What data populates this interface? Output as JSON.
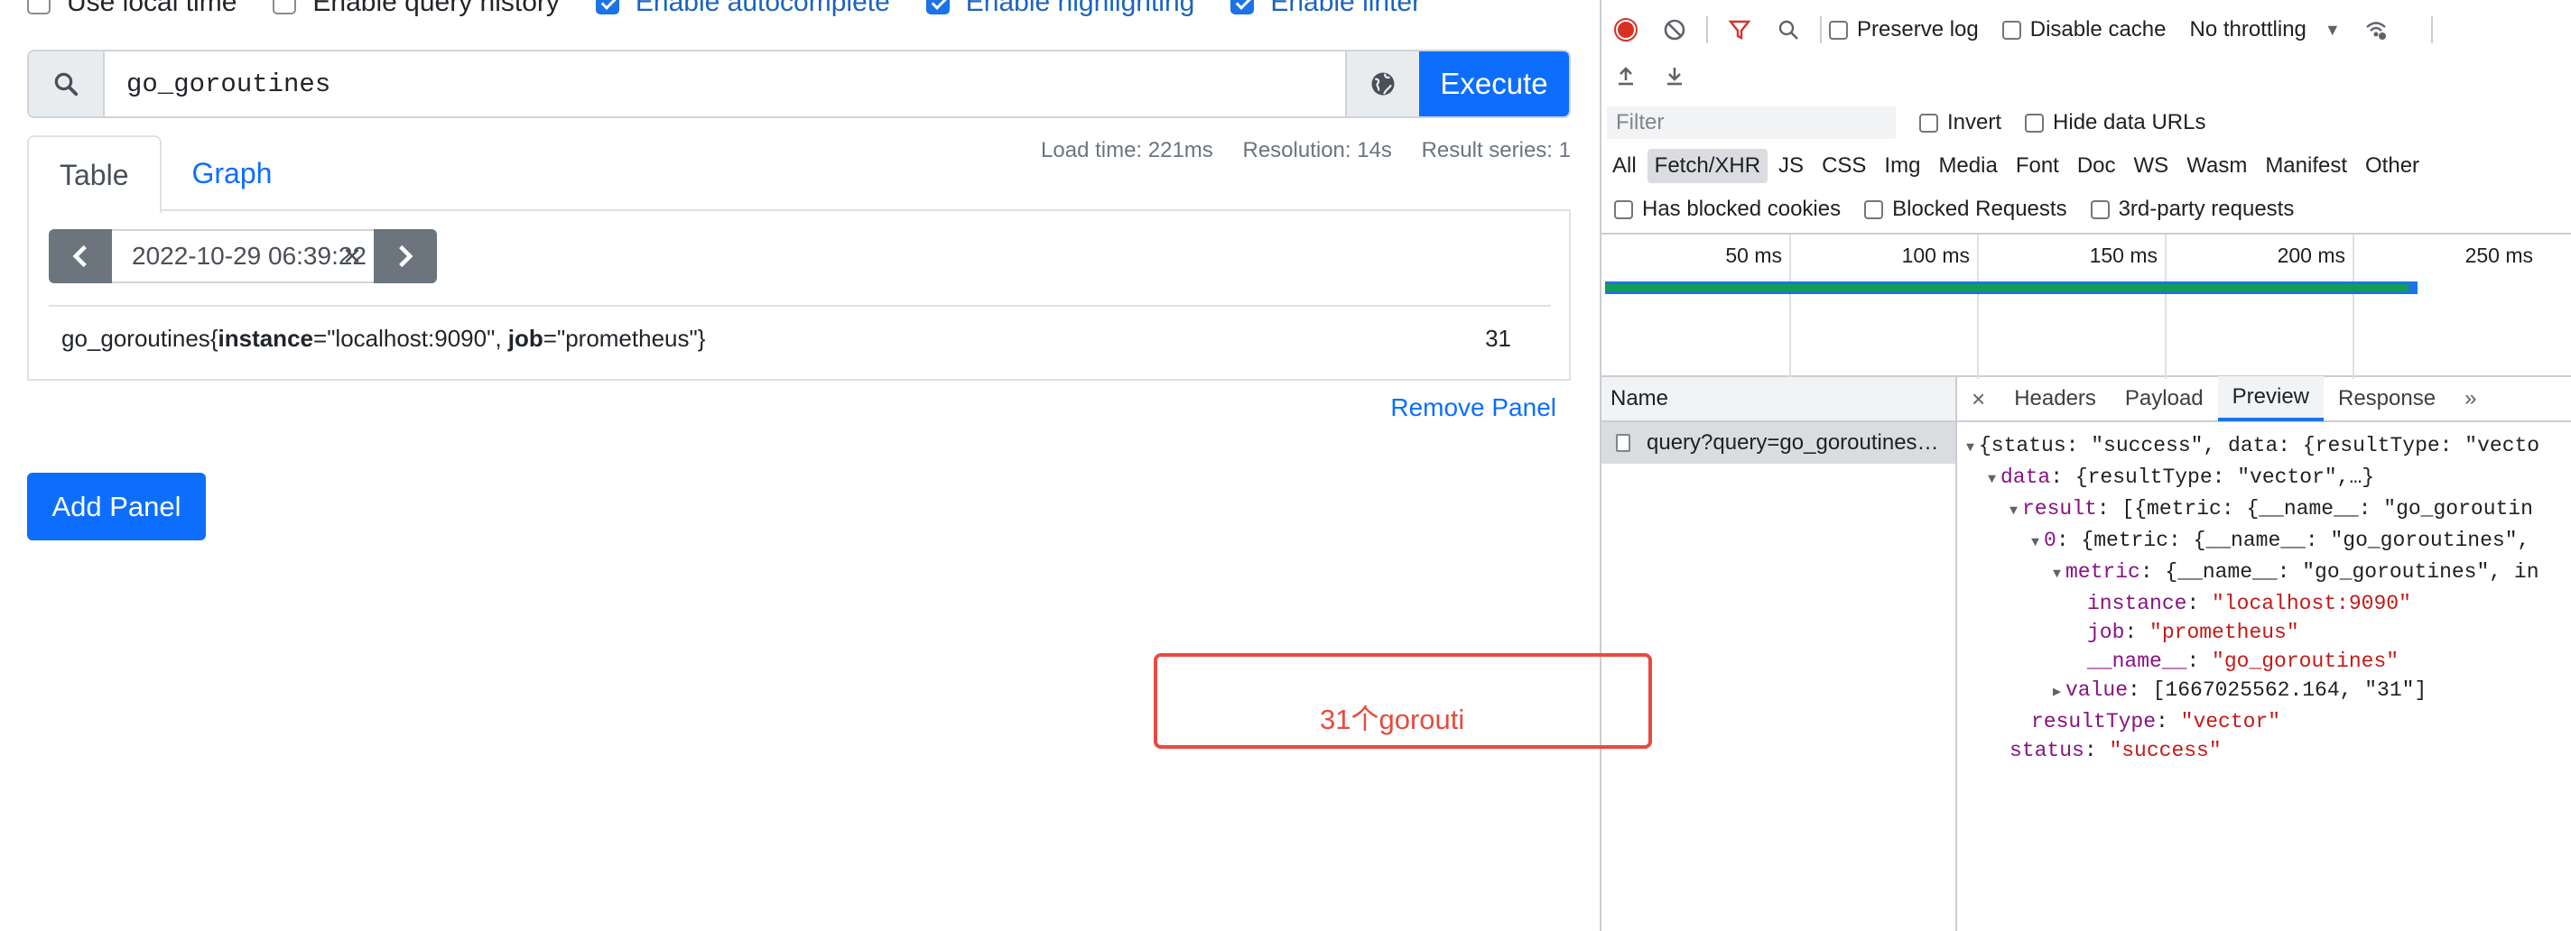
{
  "prometheus": {
    "options": [
      {
        "label": "Use local time",
        "checked": false
      },
      {
        "label": "Enable query history",
        "checked": false
      },
      {
        "label": "Enable autocomplete",
        "checked": true
      },
      {
        "label": "Enable highlighting",
        "checked": true
      },
      {
        "label": "Enable linter",
        "checked": true
      }
    ],
    "query": {
      "value": "go_goroutines",
      "execute_label": "Execute"
    },
    "tabs": [
      {
        "label": "Table",
        "active": true
      },
      {
        "label": "Graph",
        "active": false
      }
    ],
    "stats": {
      "load_time": "Load time: 221ms",
      "resolution": "Resolution: 14s",
      "result_series": "Result series: 1"
    },
    "eval_time": "2022-10-29 06:39:22",
    "result": {
      "metric_name": "go_goroutines",
      "label1_key": "instance",
      "label1_value": "\"localhost:9090\"",
      "label2_key": "job",
      "label2_value": "\"prometheus\"",
      "value": "31"
    },
    "remove_panel": "Remove Panel",
    "add_panel": "Add Panel"
  },
  "devtools": {
    "preserve_log": "Preserve log",
    "disable_cache": "Disable cache",
    "throttling": "No throttling",
    "filter_placeholder": "Filter",
    "invert": "Invert",
    "hide_data_urls": "Hide data URLs",
    "types": [
      "All",
      "Fetch/XHR",
      "JS",
      "CSS",
      "Img",
      "Media",
      "Font",
      "Doc",
      "WS",
      "Wasm",
      "Manifest",
      "Other"
    ],
    "selected_type": "Fetch/XHR",
    "blocked_cookies": "Has blocked cookies",
    "blocked_requests": "Blocked Requests",
    "third_party": "3rd-party requests",
    "timeline_labels": [
      "50 ms",
      "100 ms",
      "150 ms",
      "200 ms",
      "250 ms"
    ],
    "name_header": "Name",
    "request_name": "query?query=go_goroutines…",
    "panel_tabs": [
      "Headers",
      "Payload",
      "Preview",
      "Response"
    ],
    "selected_panel_tab": "Preview",
    "json": {
      "l1": "{status: \"success\", data: {resultType: \"vecto",
      "l2_key": "data",
      "l2_rest": ": {resultType: \"vector\",…}",
      "l3_key": "result",
      "l3_rest": ": [{metric: {__name__: \"go_goroutin",
      "l4_key": "0",
      "l4_rest": ": {metric: {__name__: \"go_goroutines\",",
      "l5_key": "metric",
      "l5_rest": ": {__name__: \"go_goroutines\", in",
      "instance_key": "instance",
      "instance_val": "\"localhost:9090\"",
      "job_key": "job",
      "job_val": "\"prometheus\"",
      "name_key": "__name__",
      "name_val": "\"go_goroutines\"",
      "value_key": "value",
      "value_rest": ": [1667025562.164, \"31\"]",
      "rt_key": "resultType",
      "rt_val": "\"vector\"",
      "status_key": "status",
      "status_val": "\"success\""
    },
    "annotation": "31个gorouti"
  }
}
